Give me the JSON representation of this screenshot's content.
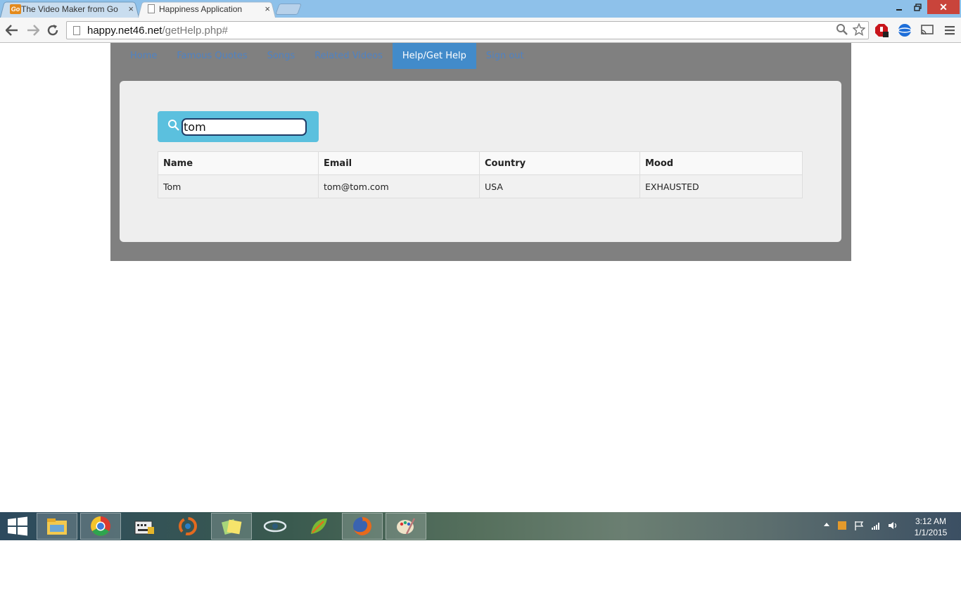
{
  "browser": {
    "tabs": [
      {
        "title": "The Video Maker from Go",
        "favicon": "goanimate-icon",
        "active": false
      },
      {
        "title": "Happiness Application",
        "favicon": "page-icon",
        "active": true
      }
    ],
    "url_host": "happy.net46.net",
    "url_path": "/getHelp.php#",
    "close_glyph": "×",
    "window_close_glyph": "✕"
  },
  "site": {
    "nav": [
      {
        "label": "Home",
        "active": false
      },
      {
        "label": "Famous Quotes",
        "active": false
      },
      {
        "label": "Songs",
        "active": false
      },
      {
        "label": "Related Videos",
        "active": false
      },
      {
        "label": "Help/Get Help",
        "active": true
      },
      {
        "label": "Sign out",
        "active": false
      }
    ],
    "search": {
      "value": "tom"
    },
    "table": {
      "headers": [
        "Name",
        "Email",
        "Country",
        "Mood"
      ],
      "rows": [
        [
          "Tom",
          "tom@tom.com",
          "USA",
          "EXHAUSTED"
        ]
      ]
    }
  },
  "taskbar": {
    "time": "3:12 AM",
    "date": "1/1/2015"
  },
  "colors": {
    "active_nav": "#428bca",
    "nav_link": "#4f82c2",
    "search_bg": "#5bc0de",
    "site_bg": "#808080",
    "panel_bg": "#eeeeee"
  }
}
